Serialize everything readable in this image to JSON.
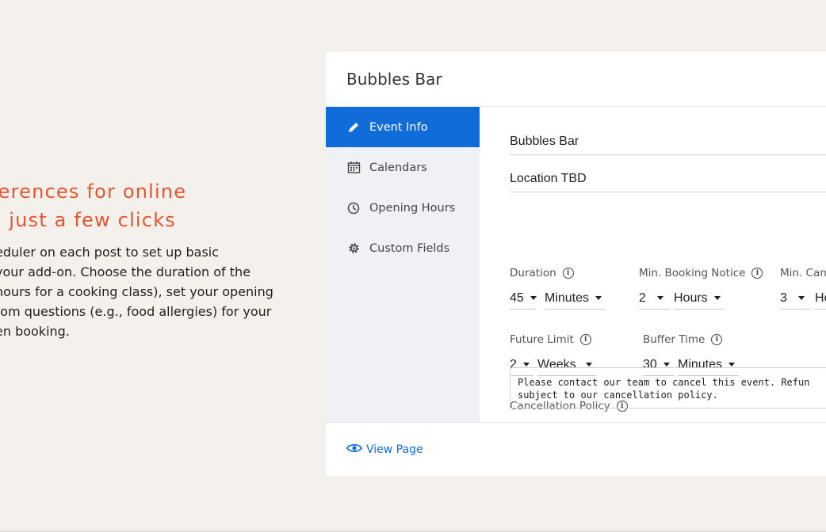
{
  "marketing": {
    "headline_line1": "ferences for online",
    "headline_line2": "n just a few clicks",
    "body_lines": [
      "eduler on each post to set up basic",
      "your add-on. Choose the duration of the",
      "hours for a cooking class), set your opening",
      "tom questions (e.g., food allergies) for your",
      "en booking."
    ]
  },
  "card": {
    "title": "Bubbles Bar",
    "sidebar": {
      "items": [
        {
          "label": "Event Info",
          "icon": "pencil-icon",
          "active": true
        },
        {
          "label": "Calendars",
          "icon": "calendar-icon",
          "active": false
        },
        {
          "label": "Opening Hours",
          "icon": "clock-icon",
          "active": false
        },
        {
          "label": "Custom Fields",
          "icon": "gear-icon",
          "active": false
        }
      ]
    },
    "form": {
      "event_name": "Bubbles Bar",
      "location": "Location TBD",
      "duration": {
        "label": "Duration",
        "value": "45",
        "unit": "Minutes"
      },
      "min_booking_notice": {
        "label": "Min. Booking Notice",
        "value": "2",
        "unit": "Hours"
      },
      "min_cancel": {
        "label": "Min. Canc",
        "value": "3",
        "unit": "Ho"
      },
      "future_limit": {
        "label": "Future Limit",
        "value": "2",
        "unit": "Weeks"
      },
      "buffer_time": {
        "label": "Buffer Time",
        "value": "30",
        "unit": "Minutes"
      },
      "cancellation_policy": {
        "label": "Cancellation Policy",
        "text": "Please contact our team to cancel this event. Refun\nsubject to our cancellation policy."
      }
    },
    "footer": {
      "view_page": "View Page"
    }
  },
  "colors": {
    "accent": "#0f6cd8",
    "headline": "#e8542f",
    "background": "#f4f0ec"
  }
}
